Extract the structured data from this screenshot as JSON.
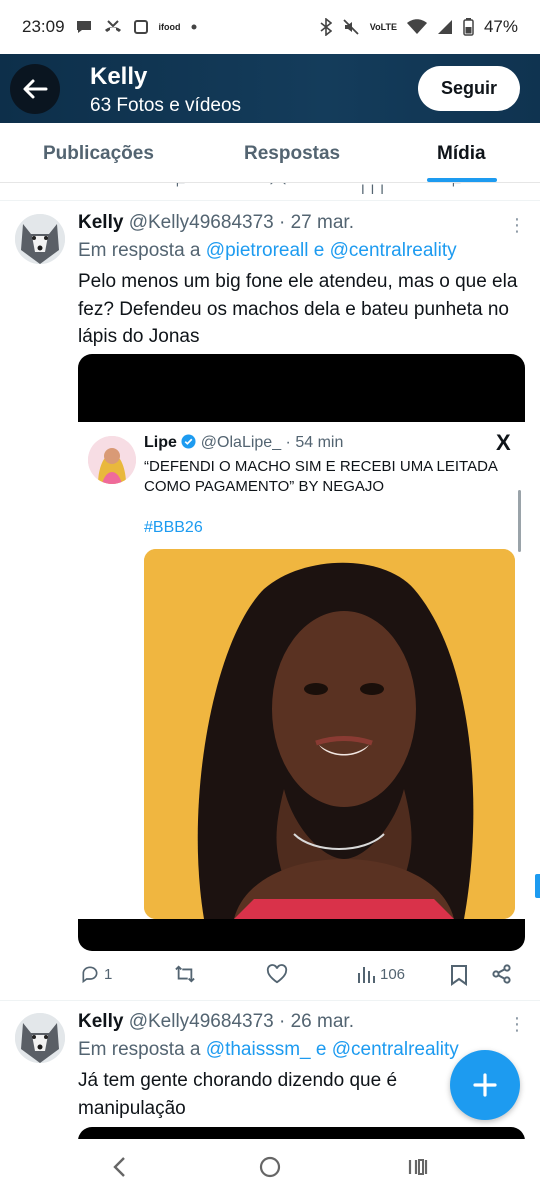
{
  "status_bar": {
    "time": "23:09",
    "ifood_label": "ifood",
    "network_label": "VoLTE",
    "battery": "47%"
  },
  "header": {
    "name": "Kelly",
    "subtitle": "63 Fotos e vídeos",
    "follow_label": "Seguir"
  },
  "tabs": [
    {
      "label": "Publicações",
      "active": false
    },
    {
      "label": "Respostas",
      "active": false
    },
    {
      "label": "Mídia",
      "active": true
    }
  ],
  "tweets": [
    {
      "name": "Kelly",
      "handle": "@Kelly49684373",
      "date": "· 27 mar.",
      "reply_prefix": "Em resposta a",
      "reply_user1": "@pietroreall",
      "reply_conj": "e",
      "reply_user2": "@centralreality",
      "text": "Pelo menos um big fone ele atendeu, mas o que ela fez? Defendeu os machos dela e bateu punheta no lápis do Jonas",
      "quote": {
        "name": "Lipe",
        "handle": "@OlaLipe_",
        "time": "· 54 min",
        "x_glyph": "X",
        "text": "“DEFENDI O MACHO SIM E RECEBI UMA LEITADA COMO PAGAMENTO” BY NEGAJO",
        "hashtag": "#BBB26"
      },
      "actions": {
        "replies": "1",
        "retweets": "",
        "likes": "",
        "views": "106"
      }
    },
    {
      "name": "Kelly",
      "handle": "@Kelly49684373",
      "date": "· 26 mar.",
      "reply_prefix": "Em resposta a",
      "reply_user1": "@thaisssm_",
      "reply_conj": "e",
      "reply_user2": "@centralreality",
      "text": "Já tem gente chorando dizendo que é manipulação"
    }
  ],
  "colors": {
    "accent": "#1d9bf0",
    "header_bg": "#143c5b",
    "photo_bg": "#f0b640"
  }
}
